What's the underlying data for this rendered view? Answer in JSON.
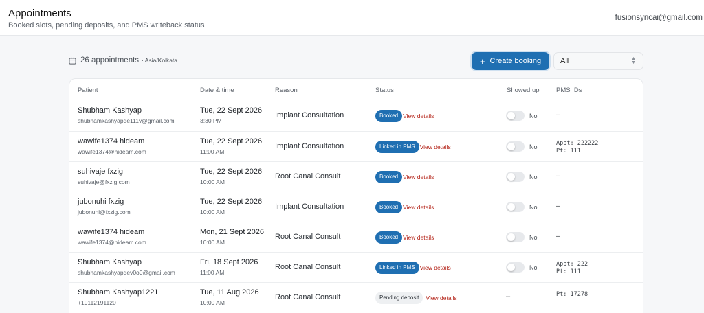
{
  "header": {
    "title": "Appointments",
    "subtitle": "Booked slots, pending deposits, and PMS writeback status",
    "user_email": "fusionsyncai@gmail.com"
  },
  "toolbar": {
    "count_label": "26 appointments",
    "timezone": "· Asia/Kolkata",
    "create_button": "Create booking",
    "filter_value": "All"
  },
  "table": {
    "columns": [
      "Patient",
      "Date & time",
      "Reason",
      "Status",
      "Showed up",
      "PMS IDs"
    ],
    "rows": [
      {
        "name": "Shubham Kashyap",
        "email": "shubhamkashyapde111v@gmail.com",
        "date": "Tue, 22 Sept 2026",
        "time": "3:30 PM",
        "reason": "Implant Consultation",
        "status": "Booked",
        "status_kind": "booked",
        "link": "View details",
        "showed": "No",
        "pms_appt": "",
        "pms_pt": ""
      },
      {
        "name": "wawife1374 hideam",
        "email": "wawife1374@hideam.com",
        "date": "Tue, 22 Sept 2026",
        "time": "11:00 AM",
        "reason": "Implant Consultation",
        "status": "Linked in PMS",
        "status_kind": "linked",
        "link": "View details",
        "showed": "No",
        "pms_appt": "Appt: 222222",
        "pms_pt": "Pt: 111"
      },
      {
        "name": "suhivaje fxzig",
        "email": "suhivaje@fxzig.com",
        "date": "Tue, 22 Sept 2026",
        "time": "10:00 AM",
        "reason": "Root Canal Consult",
        "status": "Booked",
        "status_kind": "booked",
        "link": "View details",
        "showed": "No",
        "pms_appt": "",
        "pms_pt": ""
      },
      {
        "name": "jubonuhi fxzig",
        "email": "jubonuhi@fxzig.com",
        "date": "Tue, 22 Sept 2026",
        "time": "10:00 AM",
        "reason": "Implant Consultation",
        "status": "Booked",
        "status_kind": "booked",
        "link": "View details",
        "showed": "No",
        "pms_appt": "",
        "pms_pt": ""
      },
      {
        "name": "wawife1374 hideam",
        "email": "wawife1374@hideam.com",
        "date": "Mon, 21 Sept 2026",
        "time": "10:00 AM",
        "reason": "Root Canal Consult",
        "status": "Booked",
        "status_kind": "booked",
        "link": "View details",
        "showed": "No",
        "pms_appt": "",
        "pms_pt": ""
      },
      {
        "name": "Shubham Kashyap",
        "email": "shubhamkashyapdev0o0@gmail.com",
        "date": "Fri, 18 Sept 2026",
        "time": "11:00 AM",
        "reason": "Root Canal Consult",
        "status": "Linked in PMS",
        "status_kind": "linked",
        "link": "View details",
        "showed": "No",
        "pms_appt": "Appt: 222",
        "pms_pt": "Pt: 111"
      },
      {
        "name": "Shubham Kashyap1221",
        "email": "+19112191120",
        "date": "Tue, 11 Aug 2026",
        "time": "10:00 AM",
        "reason": "Root Canal Consult",
        "status": "Pending deposit",
        "status_kind": "pending",
        "link": "View details",
        "showed": "",
        "pms_appt": "Pt: 17278",
        "pms_pt": ""
      }
    ]
  },
  "colors": {
    "primary": "#1f6fb2",
    "link": "#b42318",
    "pending_badge": "#eef0f2"
  }
}
